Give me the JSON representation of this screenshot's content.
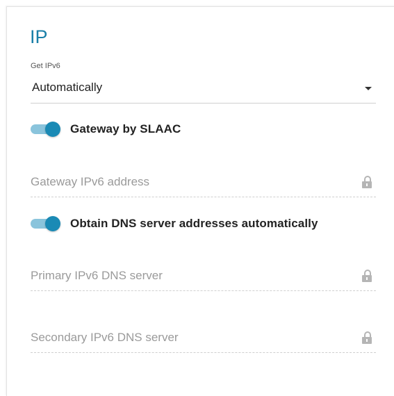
{
  "section": {
    "title": "IP"
  },
  "get_ipv6": {
    "label": "Get IPv6",
    "value": "Automatically"
  },
  "gateway_slaac": {
    "label": "Gateway by SLAAC",
    "enabled": true
  },
  "gateway_ipv6": {
    "placeholder": "Gateway IPv6 address",
    "locked": true
  },
  "obtain_dns": {
    "label": "Obtain DNS server addresses automatically",
    "enabled": true
  },
  "primary_dns": {
    "placeholder": "Primary IPv6 DNS server",
    "locked": true
  },
  "secondary_dns": {
    "placeholder": "Secondary IPv6 DNS server",
    "locked": true
  },
  "colors": {
    "accent": "#1a8ab5",
    "accent_light": "#8ac4dc",
    "title": "#1a7fa8",
    "placeholder": "#9a9a9a",
    "lock": "#b5b5b5"
  },
  "icons": {
    "dropdown": "chevron-down-icon",
    "field_lock": "lock-icon"
  }
}
